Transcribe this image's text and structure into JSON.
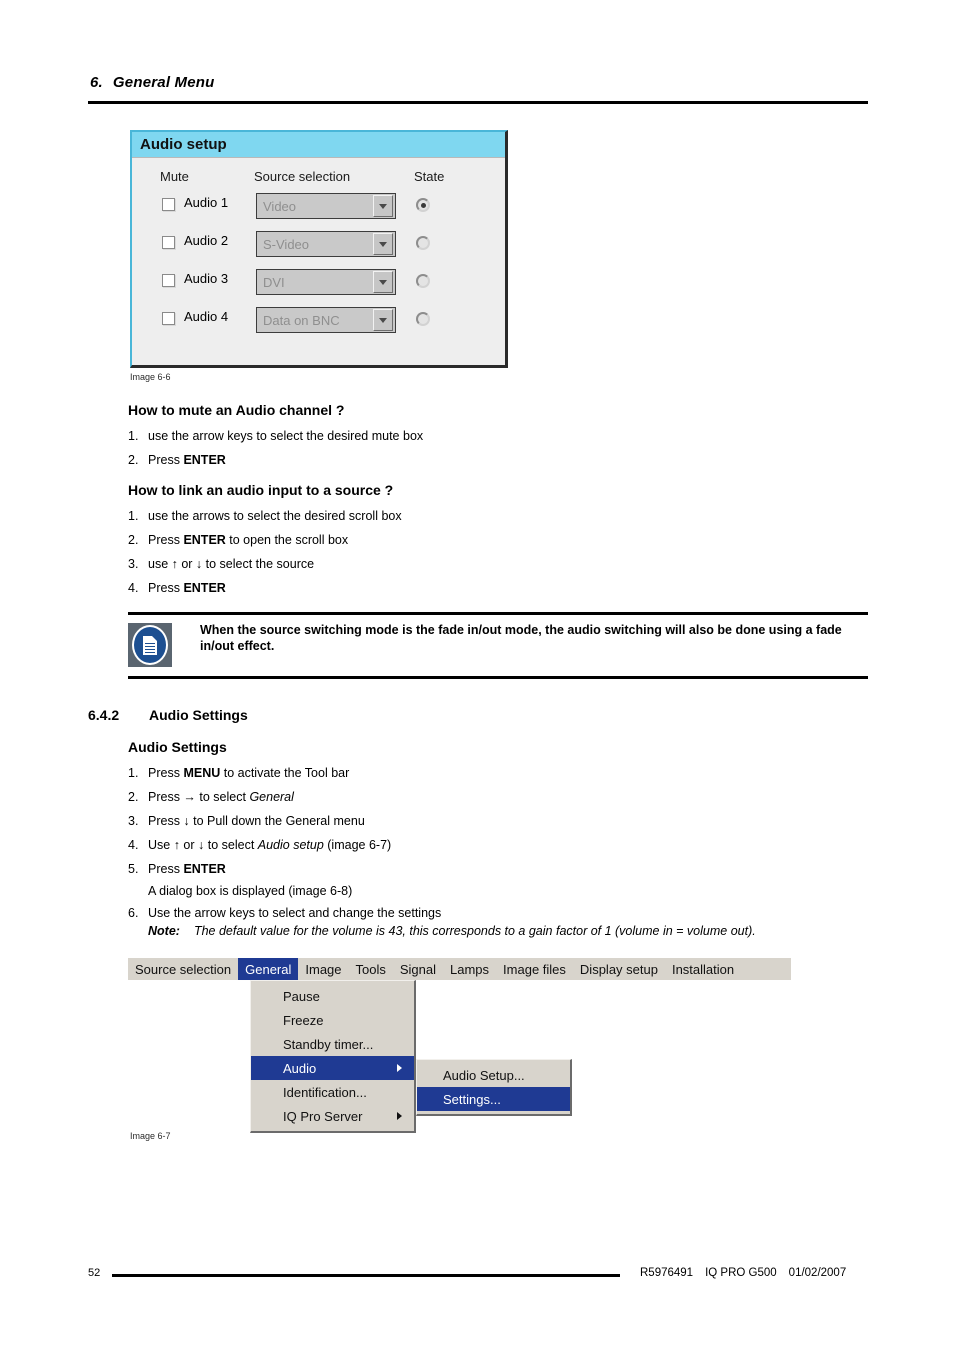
{
  "page": {
    "chapter_number": "6.",
    "chapter_title": "General Menu",
    "page_number": "52"
  },
  "dialog_audio_setup": {
    "title": "Audio setup",
    "headers": {
      "mute": "Mute",
      "source": "Source selection",
      "state": "State"
    },
    "rows": [
      {
        "label": "Audio 1",
        "source": "Video",
        "muted": false,
        "state_selected": true
      },
      {
        "label": "Audio 2",
        "source": "S-Video",
        "muted": false,
        "state_selected": false
      },
      {
        "label": "Audio 3",
        "source": "DVI",
        "muted": false,
        "state_selected": false
      },
      {
        "label": "Audio 4",
        "source": "Data on BNC",
        "muted": false,
        "state_selected": false
      }
    ],
    "caption": "Image 6-6"
  },
  "section_mute": {
    "heading": "How to mute an Audio channel ?",
    "steps": [
      {
        "n": "1.",
        "pre": "use the arrow keys to select the desired mute box",
        "bold": "",
        "post": ""
      },
      {
        "n": "2.",
        "pre": "Press ",
        "bold": "ENTER",
        "post": ""
      }
    ]
  },
  "section_link": {
    "heading": "How to link an audio input to a source ?",
    "steps": [
      {
        "n": "1.",
        "pre": "use the arrows to select the desired scroll box",
        "bold": "",
        "post": ""
      },
      {
        "n": "2.",
        "pre": "Press ",
        "bold": "ENTER",
        "post": " to open the scroll box"
      },
      {
        "n": "3.",
        "pre": "use ↑ or ↓ to select the source",
        "bold": "",
        "post": ""
      },
      {
        "n": "4.",
        "pre": "Press ",
        "bold": "ENTER",
        "post": ""
      }
    ]
  },
  "note_box": {
    "icon": "note-document-icon",
    "text": "When the source switching mode is the fade in/out mode, the audio switching will also be done using a fade in/out effect."
  },
  "section_642": {
    "number": "6.4.2",
    "title": "Audio Settings",
    "subheading": "Audio Settings",
    "steps": [
      {
        "n": "1.",
        "pre": "Press ",
        "bold": "MENU",
        "post": " to activate the Tool bar",
        "italic": ""
      },
      {
        "n": "2.",
        "pre": "Press → to select ",
        "bold": "",
        "post": "",
        "italic": "General"
      },
      {
        "n": "3.",
        "pre": "Press ↓ to Pull down the General menu",
        "bold": "",
        "post": "",
        "italic": ""
      },
      {
        "n": "4.",
        "pre": "Use ↑ or ↓ to select ",
        "bold": "",
        "post": " (image 6-7)",
        "italic": "Audio setup"
      },
      {
        "n": "5.",
        "pre": "Press ",
        "bold": "ENTER",
        "post": "",
        "italic": ""
      }
    ],
    "dialog_line": "A dialog box is displayed (image 6-8)",
    "step6": {
      "n": "6.",
      "text": "Use the arrow keys to select and change the settings"
    },
    "note_label": "Note:",
    "note_text": "The default value for the volume is 43, this corresponds to a gain factor of 1 (volume in = volume out)."
  },
  "menu_screenshot": {
    "menubar": [
      {
        "label": "Source selection",
        "active": false
      },
      {
        "label": "General",
        "active": true
      },
      {
        "label": "Image",
        "active": false
      },
      {
        "label": "Tools",
        "active": false
      },
      {
        "label": "Signal",
        "active": false
      },
      {
        "label": "Lamps",
        "active": false
      },
      {
        "label": "Image files",
        "active": false
      },
      {
        "label": "Display setup",
        "active": false
      },
      {
        "label": "Installation",
        "active": false
      }
    ],
    "dropdown": [
      {
        "label": "Pause",
        "selected": false,
        "has_submenu": false
      },
      {
        "label": "Freeze",
        "selected": false,
        "has_submenu": false
      },
      {
        "label": "Standby timer...",
        "selected": false,
        "has_submenu": false
      },
      {
        "label": "Audio",
        "selected": true,
        "has_submenu": true
      },
      {
        "label": "Identification...",
        "selected": false,
        "has_submenu": false
      },
      {
        "label": "IQ Pro Server",
        "selected": false,
        "has_submenu": true
      }
    ],
    "submenu": [
      {
        "label": "Audio Setup...",
        "selected": false
      },
      {
        "label": "Settings...",
        "selected": true
      }
    ],
    "caption": "Image 6-7"
  },
  "footer": {
    "page": "52",
    "part_number": "R5976491",
    "product": "IQ PRO G500",
    "date": "01/02/2007"
  },
  "colors": {
    "dialog_title_bg": "#7fd7f0",
    "dialog_border": "#49b6d8",
    "menu_highlight": "#1f3a93",
    "menu_bg": "#d8d4cc",
    "note_icon_bg": "#5a6570",
    "note_icon_circle": "#1d4f91"
  }
}
